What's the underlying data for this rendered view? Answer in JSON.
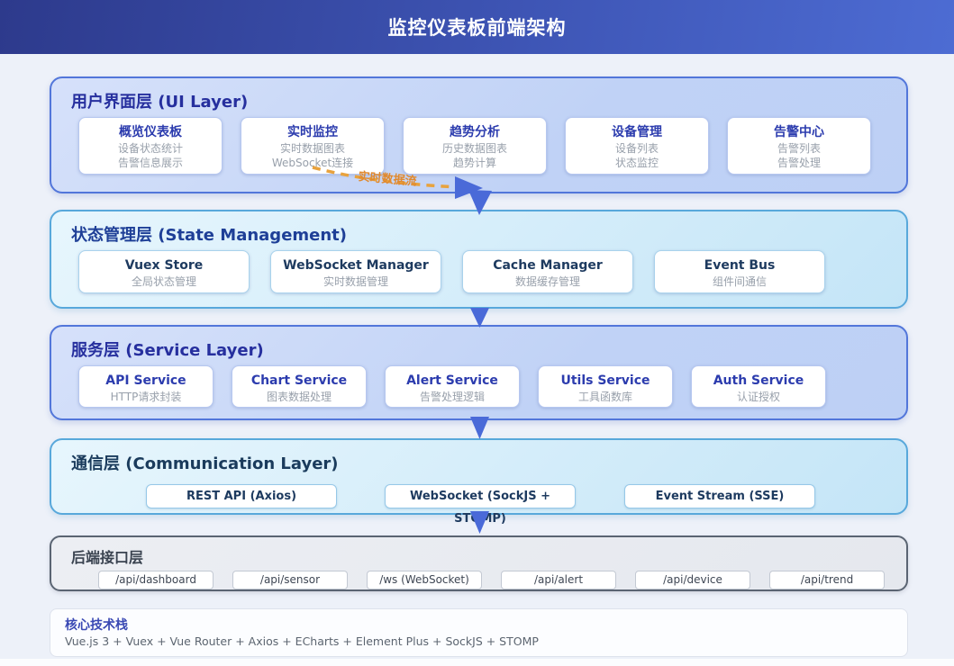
{
  "header": {
    "title": "监控仪表板前端架构"
  },
  "flow": {
    "realtime_label": "实时数据流",
    "arrow_color": "#4a6ad8",
    "dash_color": "#e8a23d"
  },
  "layers": {
    "ui": {
      "title": "用户界面层 (UI Layer)",
      "cards": [
        {
          "title": "概览仪表板",
          "line1": "设备状态统计",
          "line2": "告警信息展示"
        },
        {
          "title": "实时监控",
          "line1": "实时数据图表",
          "line2": "WebSocket连接"
        },
        {
          "title": "趋势分析",
          "line1": "历史数据图表",
          "line2": "趋势计算"
        },
        {
          "title": "设备管理",
          "line1": "设备列表",
          "line2": "状态监控"
        },
        {
          "title": "告警中心",
          "line1": "告警列表",
          "line2": "告警处理"
        }
      ]
    },
    "state": {
      "title": "状态管理层 (State Management)",
      "cards": [
        {
          "title": "Vuex Store",
          "line1": "全局状态管理"
        },
        {
          "title": "WebSocket Manager",
          "line1": "实时数据管理"
        },
        {
          "title": "Cache Manager",
          "line1": "数据缓存管理"
        },
        {
          "title": "Event Bus",
          "line1": "组件间通信"
        }
      ]
    },
    "service": {
      "title": "服务层 (Service Layer)",
      "cards": [
        {
          "title": "API Service",
          "line1": "HTTP请求封装"
        },
        {
          "title": "Chart Service",
          "line1": "图表数据处理"
        },
        {
          "title": "Alert Service",
          "line1": "告警处理逻辑"
        },
        {
          "title": "Utils Service",
          "line1": "工具函数库"
        },
        {
          "title": "Auth Service",
          "line1": "认证授权"
        }
      ]
    },
    "communication": {
      "title": "通信层 (Communication Layer)",
      "pills": [
        "REST API (Axios)",
        "WebSocket (SockJS + STOMP)",
        "Event Stream (SSE)"
      ]
    },
    "backend": {
      "title": "后端接口层",
      "endpoints": [
        "/api/dashboard",
        "/api/sensor",
        "/ws (WebSocket)",
        "/api/alert",
        "/api/device",
        "/api/trend"
      ]
    }
  },
  "tech_stack": {
    "title": "核心技术栈",
    "stack": "Vue.js 3 + Vuex + Vue Router + Axios + ECharts + Element Plus + SockJS + STOMP"
  }
}
